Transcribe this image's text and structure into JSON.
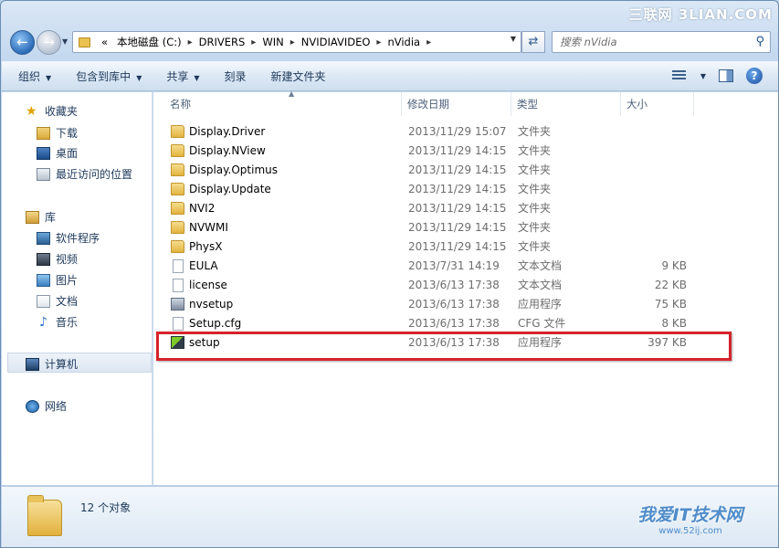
{
  "watermark_top": "三联网 3LIAN.COM",
  "address": {
    "breadcrumbs": [
      "本地磁盘 (C:)",
      "DRIVERS",
      "WIN",
      "NVIDIAVIDEO",
      "nVidia"
    ],
    "prefix": "«"
  },
  "search": {
    "placeholder": "搜索 nVidia"
  },
  "toolbar": {
    "organize": "组织",
    "include_library": "包含到库中",
    "share": "共享",
    "burn": "刻录",
    "new_folder": "新建文件夹"
  },
  "nav": {
    "favorites": "收藏夹",
    "downloads": "下载",
    "desktop": "桌面",
    "recent": "最近访问的位置",
    "libraries": "库",
    "software": "软件程序",
    "videos": "视频",
    "pictures": "图片",
    "documents": "文档",
    "music": "音乐",
    "computer": "计算机",
    "network": "网络"
  },
  "columns": {
    "name": "名称",
    "date": "修改日期",
    "type": "类型",
    "size": "大小"
  },
  "files": [
    {
      "name": "Display.Driver",
      "date": "2013/11/29 15:07",
      "type": "文件夹",
      "size": "",
      "icon": "folder-icon"
    },
    {
      "name": "Display.NView",
      "date": "2013/11/29 14:15",
      "type": "文件夹",
      "size": "",
      "icon": "folder-icon"
    },
    {
      "name": "Display.Optimus",
      "date": "2013/11/29 14:15",
      "type": "文件夹",
      "size": "",
      "icon": "folder-icon"
    },
    {
      "name": "Display.Update",
      "date": "2013/11/29 14:15",
      "type": "文件夹",
      "size": "",
      "icon": "folder-icon"
    },
    {
      "name": "NVI2",
      "date": "2013/11/29 14:15",
      "type": "文件夹",
      "size": "",
      "icon": "folder-icon"
    },
    {
      "name": "NVWMI",
      "date": "2013/11/29 14:15",
      "type": "文件夹",
      "size": "",
      "icon": "folder-icon"
    },
    {
      "name": "PhysX",
      "date": "2013/11/29 14:15",
      "type": "文件夹",
      "size": "",
      "icon": "folder-icon"
    },
    {
      "name": "EULA",
      "date": "2013/7/31 14:19",
      "type": "文本文档",
      "size": "9 KB",
      "icon": "text-file-icon"
    },
    {
      "name": "license",
      "date": "2013/6/13 17:38",
      "type": "文本文档",
      "size": "22 KB",
      "icon": "text-file-icon"
    },
    {
      "name": "nvsetup",
      "date": "2013/6/13 17:38",
      "type": "应用程序",
      "size": "75 KB",
      "icon": "application-icon"
    },
    {
      "name": "Setup.cfg",
      "date": "2013/6/13 17:38",
      "type": "CFG 文件",
      "size": "8 KB",
      "icon": "cfg-file-icon"
    },
    {
      "name": "setup",
      "date": "2013/6/13 17:38",
      "type": "应用程序",
      "size": "397 KB",
      "icon": "nvidia-setup-icon"
    }
  ],
  "status": {
    "count": "12 个对象"
  },
  "watermark_bottom": {
    "title": "我爱IT技术网",
    "url": "www.52ij.com"
  },
  "colors": {
    "highlight_box": "#d6232a",
    "accent": "#1e395b"
  }
}
